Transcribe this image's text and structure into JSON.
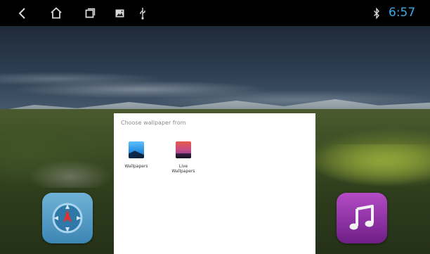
{
  "status_bar": {
    "time": "6:57",
    "icons": [
      "back-icon",
      "home-icon",
      "recent-apps-icon",
      "screenshot-icon",
      "usb-icon",
      "bluetooth-icon"
    ]
  },
  "dialog": {
    "title": "Choose wallpaper from",
    "options": [
      {
        "label": "Wallpapers",
        "icon": "wallpapers-icon"
      },
      {
        "label": "Live\nWallpapers",
        "icon": "live-wallpapers-icon"
      }
    ]
  },
  "dock": {
    "apps": [
      {
        "name": "navigation",
        "icon": "compass-icon"
      },
      {
        "name": "music",
        "icon": "music-note-icon"
      }
    ]
  },
  "colors": {
    "clock": "#3aa9e8",
    "status_bar_bg": "#000000",
    "dialog_bg": "#ffffff"
  }
}
